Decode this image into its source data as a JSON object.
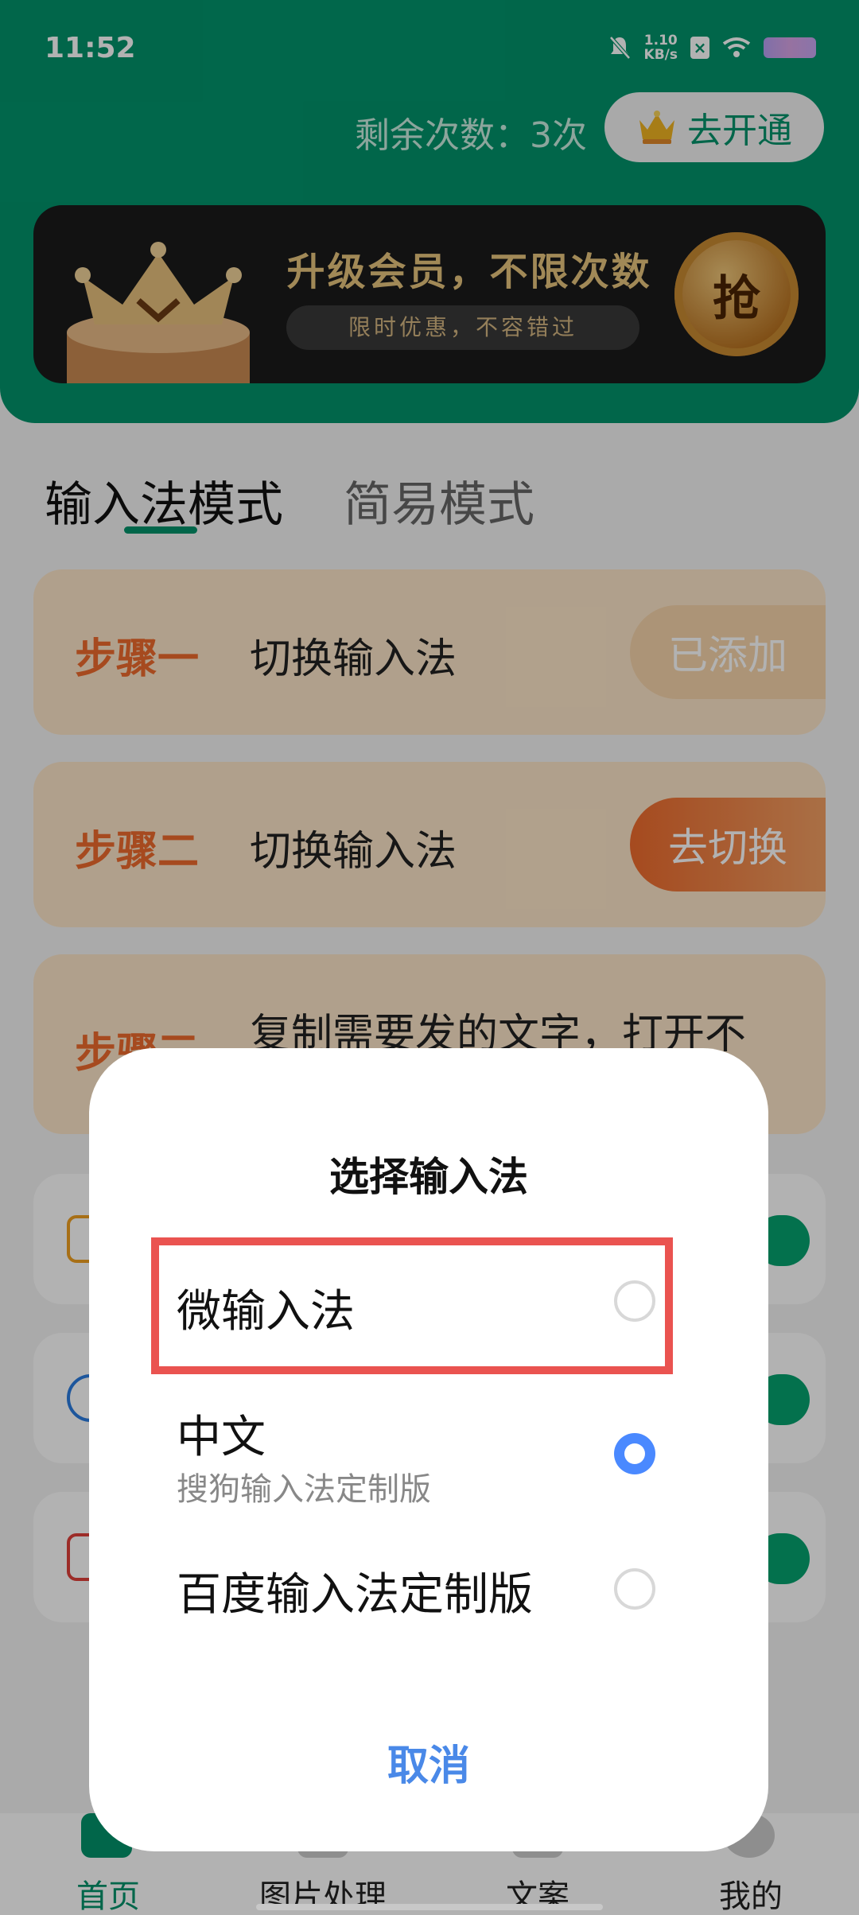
{
  "status_bar": {
    "time": "11:52",
    "net_speed_value": "1.10",
    "net_speed_unit": "KB/s"
  },
  "header": {
    "remaining": "剩余次数：3次",
    "open_button": "去开通"
  },
  "banner": {
    "title": "升级会员，不限次数",
    "subtitle": "限时优惠，不容错过",
    "grab": "抢"
  },
  "tabs": [
    {
      "label": "输入法模式",
      "active": true
    },
    {
      "label": "简易模式",
      "active": false
    }
  ],
  "steps": [
    {
      "label": "步骤一",
      "text": "切换输入法",
      "button": "已添加"
    },
    {
      "label": "步骤二",
      "text": "切换输入法",
      "button": "去切换"
    },
    {
      "label": "步骤三",
      "text": "复制需要发的文字，打开不"
    }
  ],
  "bottom_nav": [
    {
      "label": "首页",
      "active": true
    },
    {
      "label": "图片处理",
      "active": false
    },
    {
      "label": "文案",
      "active": false
    },
    {
      "label": "我的",
      "active": false
    }
  ],
  "dialog": {
    "title": "选择输入法",
    "options": [
      {
        "label": "微输入法",
        "sublabel": "",
        "selected": false
      },
      {
        "label": "中文",
        "sublabel": "搜狗输入法定制版",
        "selected": true
      },
      {
        "label": "百度输入法定制版",
        "sublabel": "",
        "selected": false
      }
    ],
    "cancel": "取消"
  },
  "colors": {
    "brand": "#02936b",
    "step_bg": "#fde6c9",
    "step_label": "#ee6a2d",
    "highlight": "#ea5350",
    "radio_checked": "#4a89ff",
    "cancel": "#4a89e8"
  }
}
